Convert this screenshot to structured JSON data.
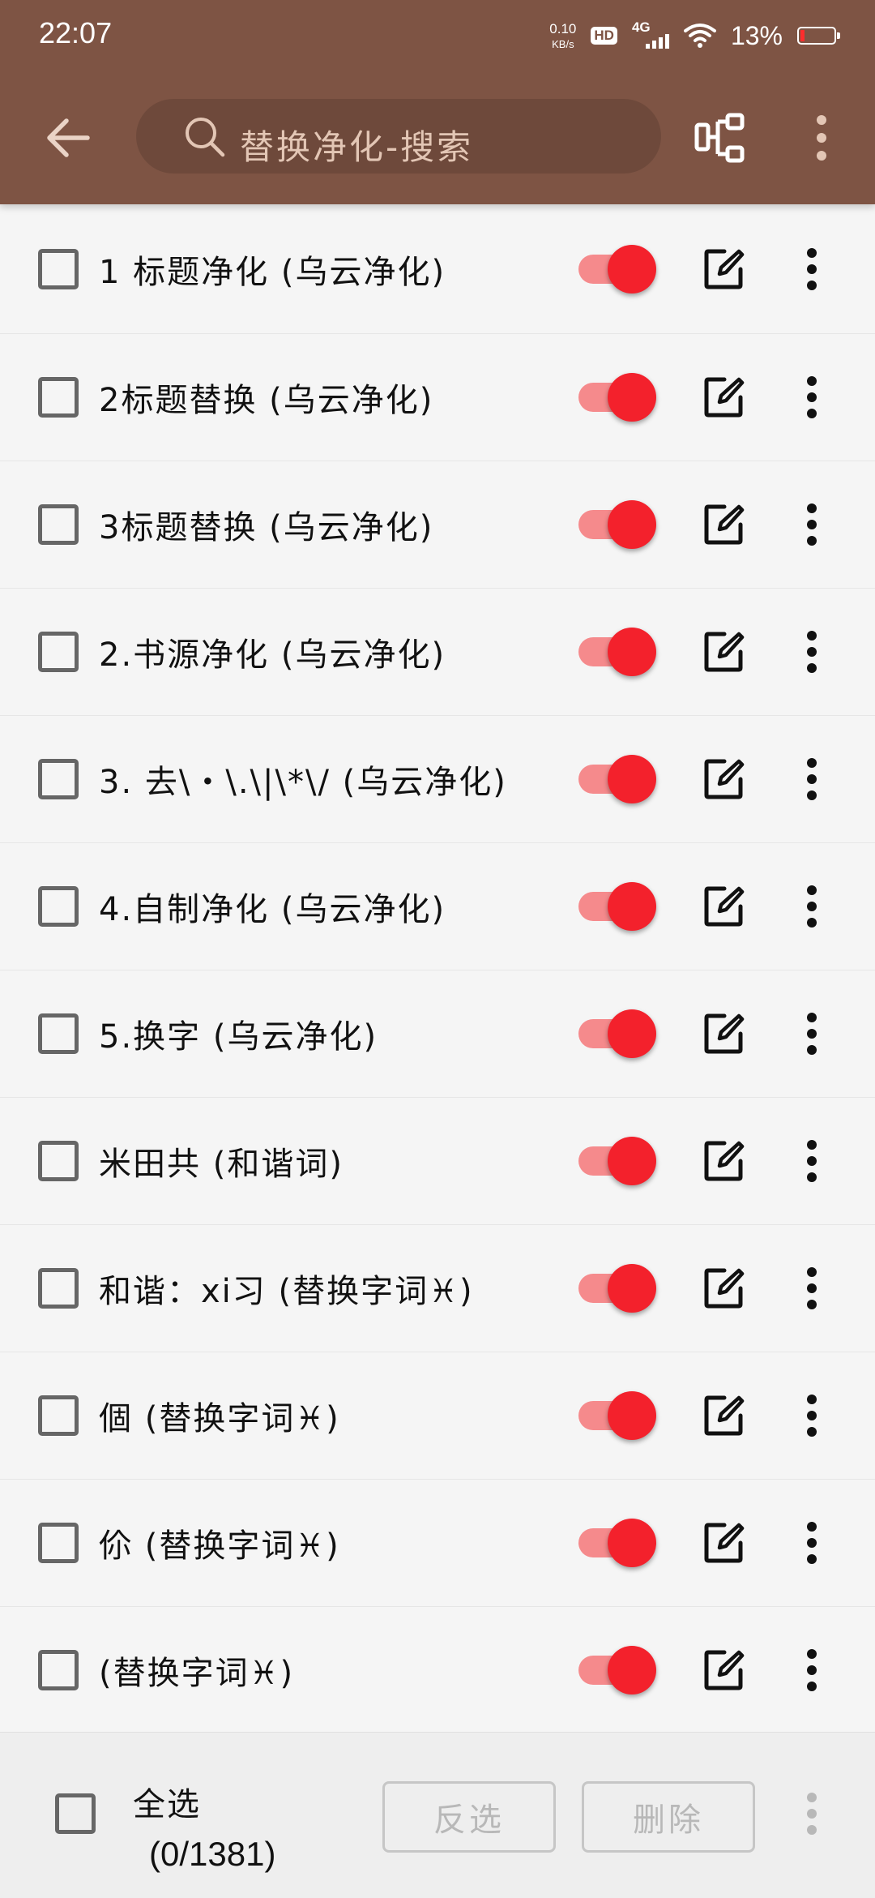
{
  "status_bar": {
    "time": "22:07",
    "net_speed_value": "0.10",
    "net_speed_unit": "KB/s",
    "hd": "HD",
    "network": "4G",
    "battery_pct": "13%",
    "battery_level": 0.13
  },
  "toolbar": {
    "search_placeholder": "替换净化-搜索",
    "icons": [
      "arrow-back-icon",
      "search-icon",
      "scan-import-icon",
      "more-vert-icon"
    ]
  },
  "rules": [
    {
      "title": "1 标题净化 (乌云净化)",
      "enabled": true
    },
    {
      "title": "2标题替换 (乌云净化)",
      "enabled": true
    },
    {
      "title": "3标题替换 (乌云净化)",
      "enabled": true
    },
    {
      "title": "2.书源净化 (乌云净化)",
      "enabled": true
    },
    {
      "title": "3.   去\\・\\.\\|\\*\\/ (乌云净化)",
      "enabled": true
    },
    {
      "title": "4.自制净化 (乌云净化)",
      "enabled": true
    },
    {
      "title": "5.换字 (乌云净化)",
      "enabled": true
    },
    {
      "title": "米田共 (和谐词)",
      "enabled": true
    },
    {
      "title": "和谐：xi习 (替换字词♓)",
      "enabled": true
    },
    {
      "title": "個 (替换字词♓)",
      "enabled": true
    },
    {
      "title": "伱 (替换字词♓)",
      "enabled": true
    },
    {
      "title": " (替换字词♓)",
      "enabled": true
    }
  ],
  "bottom_bar": {
    "select_all": "全选",
    "selection_count": "(0/1381)",
    "invert_label": "反选",
    "delete_label": "删除"
  },
  "colors": {
    "toolbar": "#7e5444",
    "toggle_thumb": "#f3212c",
    "toggle_track": "#f58a8c",
    "placeholder": "#e3c6b5"
  }
}
